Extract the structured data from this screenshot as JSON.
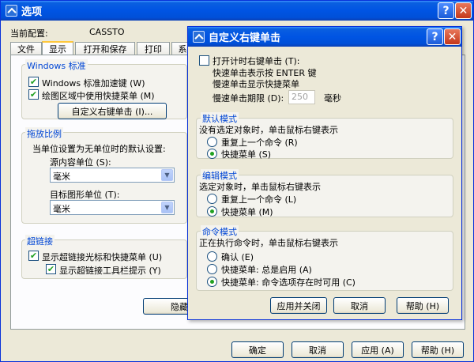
{
  "main": {
    "title": "选项",
    "help_glyph": "?",
    "close_glyph": "✕",
    "config_label": "当前配置:",
    "config_value": "CASSTO",
    "tabs": [
      "文件",
      "显示",
      "打开和保存",
      "打印",
      "系"
    ],
    "windows_group": {
      "title": "Windows 标准",
      "accel_keys": "Windows 标准加速键 (W)",
      "shortcut_menu": "绘图区域中使用快捷菜单 (M)",
      "custom_right_click_btn": "自定义右键单击 (I)..."
    },
    "scale_group": {
      "title": "拖放比例",
      "desc": "当单位设置为无单位时的默认设置:",
      "source_label": "源内容单位 (S):",
      "source_value": "毫米",
      "target_label": "目标图形单位 (T):",
      "target_value": "毫米"
    },
    "hyperlink_group": {
      "title": "超链接",
      "cursor_menu": "显示超链接光标和快捷菜单 (U)",
      "toolbar_tip": "显示超链接工具栏提示 (Y)"
    },
    "hidden_btn": "隐藏",
    "ok": "确定",
    "cancel": "取消",
    "apply": "应用 (A)",
    "help": "帮助 (H)"
  },
  "dialog": {
    "title": "自定义右键单击",
    "help_glyph": "?",
    "close_glyph": "✕",
    "timed_right_click": "打开计时右键单击 (T):",
    "quick_click_desc": "快速单击表示按 ENTER 键",
    "slow_click_desc": "慢速单击显示快捷菜单",
    "slow_period_label": "慢速单击期限 (D):",
    "slow_period_value": "250",
    "slow_period_unit": "毫秒",
    "default_mode": {
      "title": "默认模式",
      "desc": "没有选定对象时，单击鼠标右键表示",
      "repeat": "重复上一个命令 (R)",
      "shortcut": "快捷菜单 (S)",
      "selected": "shortcut"
    },
    "edit_mode": {
      "title": "编辑模式",
      "desc": "选定对象时，单击鼠标右键表示",
      "repeat": "重复上一个命令 (L)",
      "shortcut": "快捷菜单 (M)",
      "selected": "shortcut"
    },
    "command_mode": {
      "title": "命令模式",
      "desc": "正在执行命令时，单击鼠标右键表示",
      "confirm": "确认 (E)",
      "shortcut_always": "快捷菜单: 总是启用 (A)",
      "shortcut_options": "快捷菜单: 命令选项存在时可用 (C)",
      "selected": "shortcut_options"
    },
    "apply_close": "应用并关闭",
    "cancel": "取消",
    "help": "帮助 (H)"
  },
  "colors": {
    "title_blue": "#0054e3",
    "group_title": "#0046d5",
    "check_green": "#21a121",
    "face": "#ece9d8"
  }
}
